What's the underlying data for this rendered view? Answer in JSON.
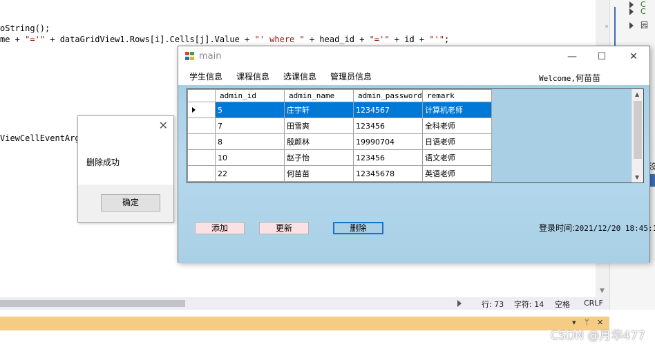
{
  "editor": {
    "line1": "oString();",
    "line2_parts": [
      "me + ",
      "\"='\"",
      " + dataGridView1.Rows[i].Cells[j].Value + ",
      "\"' where \"",
      " + head_id + ",
      "\"='\"",
      " + id + ",
      "\"'\"",
      ";"
    ],
    "line3": "ViewCellEventArgs"
  },
  "status": {
    "line": "行: 73",
    "char": "字符: 14",
    "space": "空格",
    "eol": "CRLF"
  },
  "watermark": "CSDN @月华477",
  "messagebox": {
    "close_symbol": "✕",
    "message": "删除成功",
    "ok_label": "确定"
  },
  "main_window": {
    "title": "main",
    "controls": {
      "minimize": "—",
      "maximize": "☐",
      "close": "✕"
    },
    "menu": [
      "学生信息",
      "课程信息",
      "选课信息",
      "管理员信息"
    ],
    "welcome_prefix": "Welcome,",
    "welcome_name": "何苗苗",
    "grid": {
      "columns": [
        "admin_id",
        "admin_name",
        "admin_password",
        "remark"
      ],
      "rows": [
        [
          "5",
          "庄宇轩",
          "1234567",
          "计算机老师"
        ],
        [
          "7",
          "田雪爽",
          "123456",
          "全科老师"
        ],
        [
          "8",
          "殷颜林",
          "19990704",
          "日语老师"
        ],
        [
          "10",
          "赵子怡",
          "123456",
          "语文老师"
        ],
        [
          "22",
          "何苗苗",
          "12345678",
          "英语老师"
        ]
      ],
      "selected_row": 0
    },
    "buttons": {
      "add": "添加",
      "update": "更新",
      "delete": "删除"
    },
    "login_time_label": "登录时间:",
    "login_time_value": "2021/12/20 18:45:1"
  },
  "right_panel": {
    "items": [
      "C",
      "C",
      "园"
    ],
    "fragment": "沒"
  },
  "colors": {
    "accent": "#0078d7",
    "client_bg": "#a9d0e6",
    "pink_button": "#fbe1e3",
    "yellow_bar": "#f5cc84"
  }
}
